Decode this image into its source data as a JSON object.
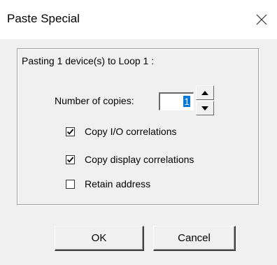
{
  "window": {
    "title": "Paste Special",
    "close_icon": "close-icon"
  },
  "group": {
    "description": "Pasting 1 device(s) to Loop 1 :"
  },
  "copies": {
    "label": "Number of copies:",
    "value": "1",
    "spin_up_icon": "triangle-up-icon",
    "spin_down_icon": "triangle-down-icon"
  },
  "options": [
    {
      "label": "Copy I/O correlations",
      "checked": true
    },
    {
      "label": "Copy display correlations",
      "checked": true
    },
    {
      "label": "Retain address",
      "checked": false
    }
  ],
  "buttons": {
    "ok_label": "OK",
    "cancel_label": "Cancel"
  },
  "colors": {
    "dialog_background": "#f0f0f0",
    "titlebar_background": "#ffffff",
    "selection_highlight": "#0078d7"
  }
}
